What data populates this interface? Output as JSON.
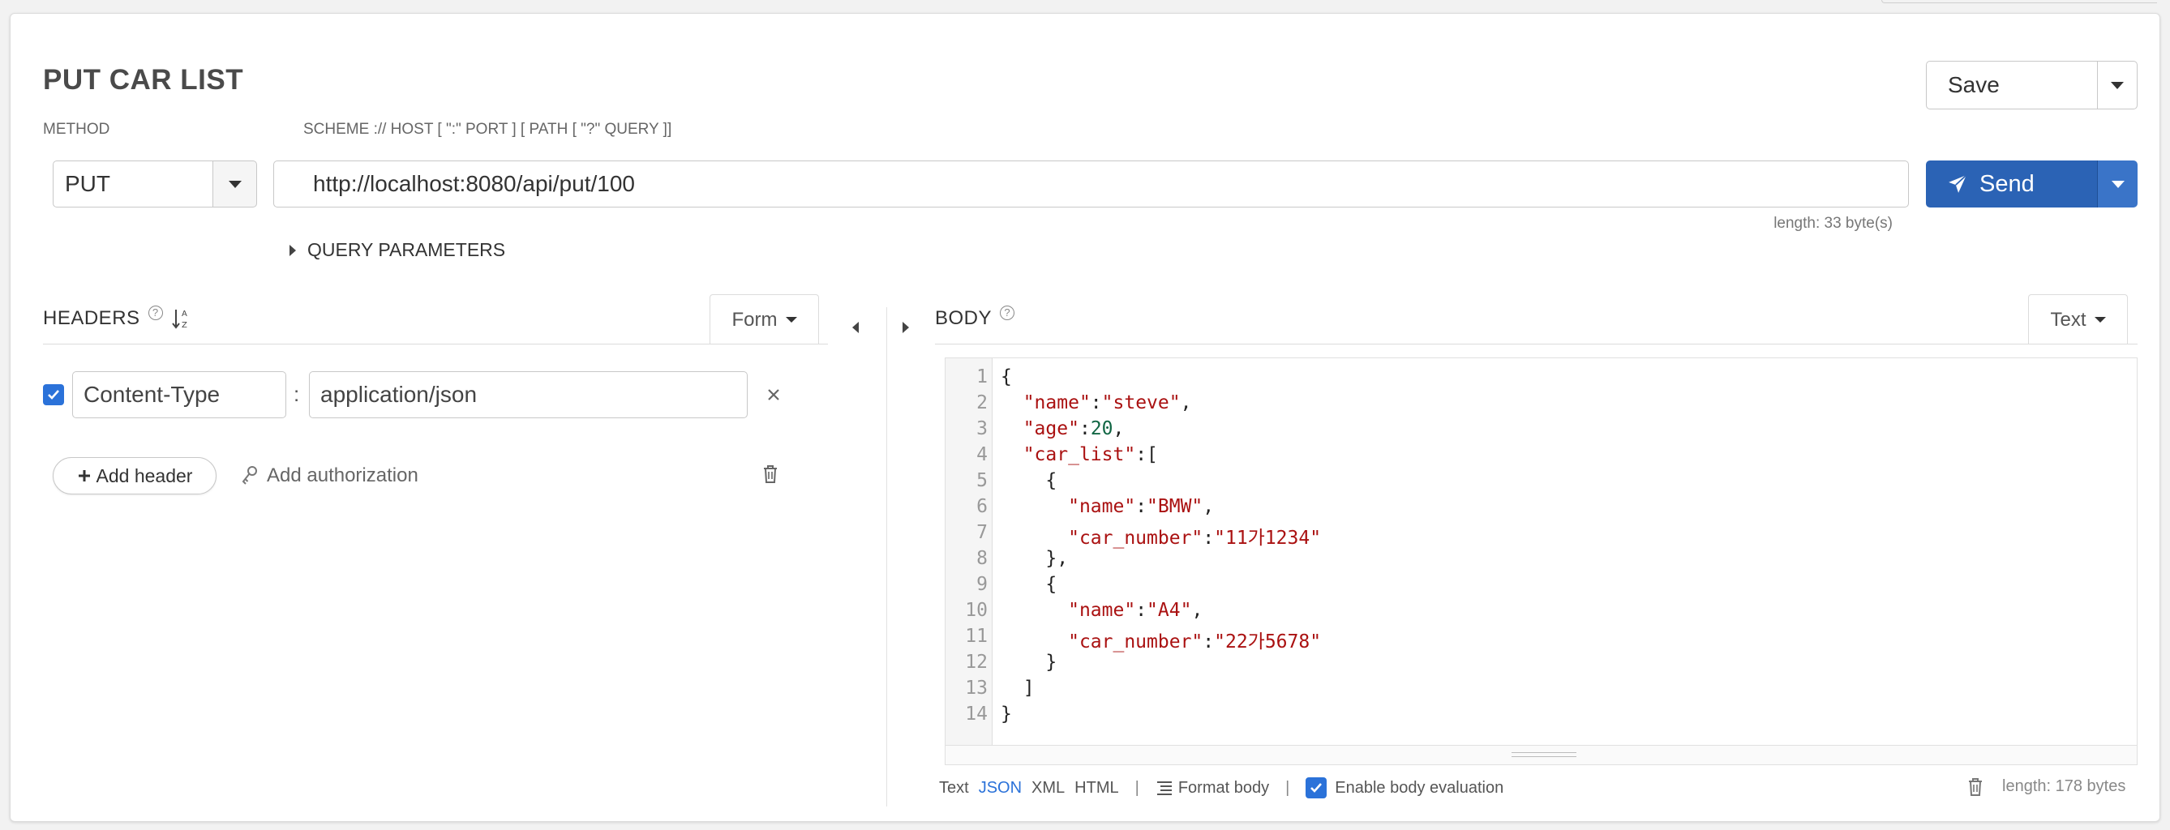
{
  "request": {
    "title": "PUT CAR LIST",
    "save_label": "Save",
    "method_label": "METHOD",
    "method_value": "PUT",
    "url_label": "SCHEME :// HOST [ \":\" PORT ] [ PATH [ \"?\" QUERY ]]",
    "url_value": "http://localhost:8080/api/put/100",
    "url_length": "length: 33 byte(s)",
    "send_label": "Send",
    "query_params_label": "QUERY PARAMETERS"
  },
  "headers": {
    "title": "HEADERS",
    "mode_label": "Form",
    "rows": [
      {
        "enabled": true,
        "name": "Content-Type",
        "separator": ":",
        "value": "application/json"
      }
    ],
    "add_header_label": "Add header",
    "add_authorization_label": "Add authorization"
  },
  "body": {
    "title": "BODY",
    "mode_label": "Text",
    "line_numbers": [
      "1",
      "2",
      "3",
      "4",
      "5",
      "6",
      "7",
      "8",
      "9",
      "10",
      "11",
      "12",
      "13",
      "14"
    ],
    "formats": [
      "Text",
      "JSON",
      "XML",
      "HTML"
    ],
    "active_format": "JSON",
    "separator": "|",
    "format_body_label": "Format body",
    "enable_eval_label": "Enable body evaluation",
    "enable_eval_checked": true,
    "length": "length: 178 bytes"
  },
  "colors": {
    "send": "#2b63b5",
    "checkbox": "#2b72d9",
    "json_string": "#aa1111",
    "json_number": "#116644",
    "active_format": "#2b72d9"
  },
  "icons": [
    "paper-plane-icon",
    "sort-alpha-icon",
    "help-icon",
    "close-icon",
    "plus-icon",
    "key-icon",
    "trash-icon",
    "format-lines-icon",
    "check-icon"
  ]
}
